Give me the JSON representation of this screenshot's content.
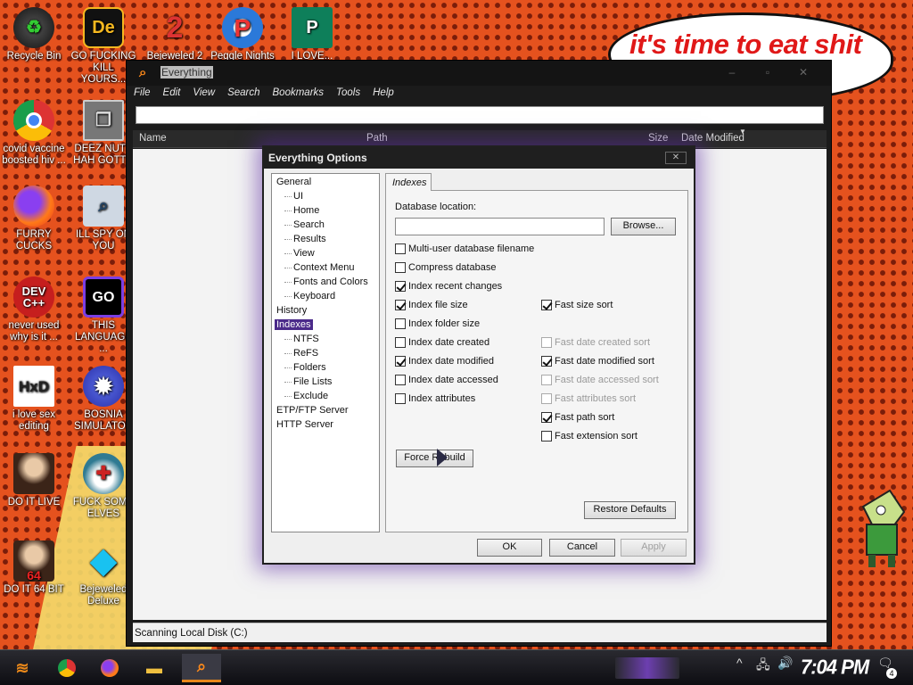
{
  "desktop": {
    "speech_bubble": "it's time to eat shit now",
    "icons": [
      {
        "label": "Recycle Bin",
        "icon": "recycle-bin-icon"
      },
      {
        "label": "GO FUCKING KILL YOURS...",
        "icon": "de-app-icon"
      },
      {
        "label": "Bejeweled 2",
        "icon": "bejeweled-2-icon"
      },
      {
        "label": "Peggle Nights",
        "icon": "peggle-icon"
      },
      {
        "label": "I LOVE...",
        "icon": "publisher-icon"
      },
      {
        "label": "covid vaccine boosted hiv ...",
        "icon": "chrome-icon"
      },
      {
        "label": "DEEZ NUTS HAH GOTT...",
        "icon": "copy-icon"
      },
      {
        "label": "FURRY CUCKS",
        "icon": "firefox-icon"
      },
      {
        "label": "ILL SPY ON YOU",
        "icon": "spy-icon"
      },
      {
        "label": "never used why is it ...",
        "icon": "devcpp-icon"
      },
      {
        "label": "THIS LANGUAGE ...",
        "icon": "goland-icon"
      },
      {
        "label": "i love sex editing",
        "icon": "hxd-icon"
      },
      {
        "label": "BOSNIA SIMULATOR",
        "icon": "mine-icon"
      },
      {
        "label": "DO IT LIVE",
        "icon": "portrait-icon"
      },
      {
        "label": "FUCK SOME ELVES",
        "icon": "santa-icon"
      },
      {
        "label": "DO IT 64 BIT",
        "icon": "portrait-64-icon"
      },
      {
        "label": "Bejeweled Deluxe",
        "icon": "diamond-icon"
      }
    ]
  },
  "main_window": {
    "title": "Everything",
    "menu": [
      "File",
      "Edit",
      "View",
      "Search",
      "Bookmarks",
      "Tools",
      "Help"
    ],
    "columns": {
      "name": "Name",
      "path": "Path",
      "size": "Size",
      "date_modified": "Date Modified"
    },
    "search_value": "",
    "status": "Scanning Local Disk (C:)"
  },
  "dialog": {
    "title": "Everything Options",
    "close": "✕",
    "tree": [
      {
        "label": "General",
        "level": 0
      },
      {
        "label": "UI",
        "level": 1
      },
      {
        "label": "Home",
        "level": 1
      },
      {
        "label": "Search",
        "level": 1
      },
      {
        "label": "Results",
        "level": 1
      },
      {
        "label": "View",
        "level": 1
      },
      {
        "label": "Context Menu",
        "level": 1
      },
      {
        "label": "Fonts and Colors",
        "level": 1
      },
      {
        "label": "Keyboard",
        "level": 1
      },
      {
        "label": "History",
        "level": 0
      },
      {
        "label": "Indexes",
        "level": 0,
        "selected": true
      },
      {
        "label": "NTFS",
        "level": 1
      },
      {
        "label": "ReFS",
        "level": 1
      },
      {
        "label": "Folders",
        "level": 1
      },
      {
        "label": "File Lists",
        "level": 1
      },
      {
        "label": "Exclude",
        "level": 1
      },
      {
        "label": "ETP/FTP Server",
        "level": 0
      },
      {
        "label": "HTTP Server",
        "level": 0
      }
    ],
    "tab": "Indexes",
    "database_location_label": "Database location:",
    "database_location_value": "",
    "browse": "Browse...",
    "left_options": [
      {
        "label": "Multi-user database filename",
        "checked": false
      },
      {
        "label": "Compress database",
        "checked": false
      },
      {
        "label": "Index recent changes",
        "checked": true
      },
      {
        "label": "Index file size",
        "checked": true
      },
      {
        "label": "Index folder size",
        "checked": false
      },
      {
        "label": "Index date created",
        "checked": false
      },
      {
        "label": "Index date modified",
        "checked": true
      },
      {
        "label": "Index date accessed",
        "checked": false
      },
      {
        "label": "Index attributes",
        "checked": false
      }
    ],
    "right_options": [
      {
        "label": "Fast size sort",
        "checked": true,
        "disabled": false
      },
      {
        "label": "Fast date created sort",
        "checked": false,
        "disabled": true
      },
      {
        "label": "Fast date modified sort",
        "checked": true,
        "disabled": false
      },
      {
        "label": "Fast date accessed sort",
        "checked": false,
        "disabled": true
      },
      {
        "label": "Fast attributes sort",
        "checked": false,
        "disabled": true
      },
      {
        "label": "Fast path sort",
        "checked": true,
        "disabled": false
      },
      {
        "label": "Fast extension sort",
        "checked": false,
        "disabled": false
      }
    ],
    "force_rebuild": "Force Rebuild",
    "restore_defaults": "Restore Defaults",
    "ok": "OK",
    "cancel": "Cancel",
    "apply": "Apply"
  },
  "taskbar": {
    "clock": "7:04 PM",
    "notification_count": "4",
    "accent": "#e8871a"
  }
}
